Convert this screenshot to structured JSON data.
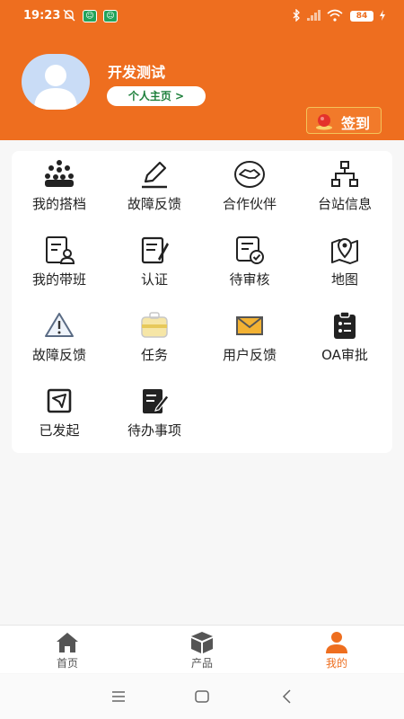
{
  "status_bar": {
    "time": "19:23",
    "battery": "84",
    "icons": [
      "mute-icon",
      "app-badge-icon",
      "app-badge-icon",
      "bluetooth-icon",
      "signal-icon",
      "wifi-icon",
      "charging-icon"
    ]
  },
  "profile": {
    "name": "开发测试",
    "home_button": "个人主页 >",
    "checkin_label": "签到"
  },
  "grid": [
    {
      "label": "我的搭档",
      "icon": "team-icon"
    },
    {
      "label": "故障反馈",
      "icon": "pen-icon"
    },
    {
      "label": "合作伙伴",
      "icon": "handshake-icon"
    },
    {
      "label": "台站信息",
      "icon": "network-icon"
    },
    {
      "label": "我的带班",
      "icon": "document-user-icon"
    },
    {
      "label": "认证",
      "icon": "certificate-icon"
    },
    {
      "label": "待审核",
      "icon": "review-icon"
    },
    {
      "label": "地图",
      "icon": "map-icon"
    },
    {
      "label": "故障反馈",
      "icon": "warning-icon"
    },
    {
      "label": "任务",
      "icon": "briefcase-icon"
    },
    {
      "label": "用户反馈",
      "icon": "mail-icon"
    },
    {
      "label": "OA审批",
      "icon": "clipboard-icon"
    },
    {
      "label": "已发起",
      "icon": "send-icon"
    },
    {
      "label": "待办事项",
      "icon": "todo-icon"
    }
  ],
  "bottom_nav": [
    {
      "label": "首页",
      "icon": "home-icon"
    },
    {
      "label": "产品",
      "icon": "box-icon"
    },
    {
      "label": "我的",
      "icon": "person-icon",
      "active": true
    }
  ],
  "colors": {
    "accent": "#ee6e1f",
    "card": "#ffffff",
    "background": "#f7f7f7"
  }
}
